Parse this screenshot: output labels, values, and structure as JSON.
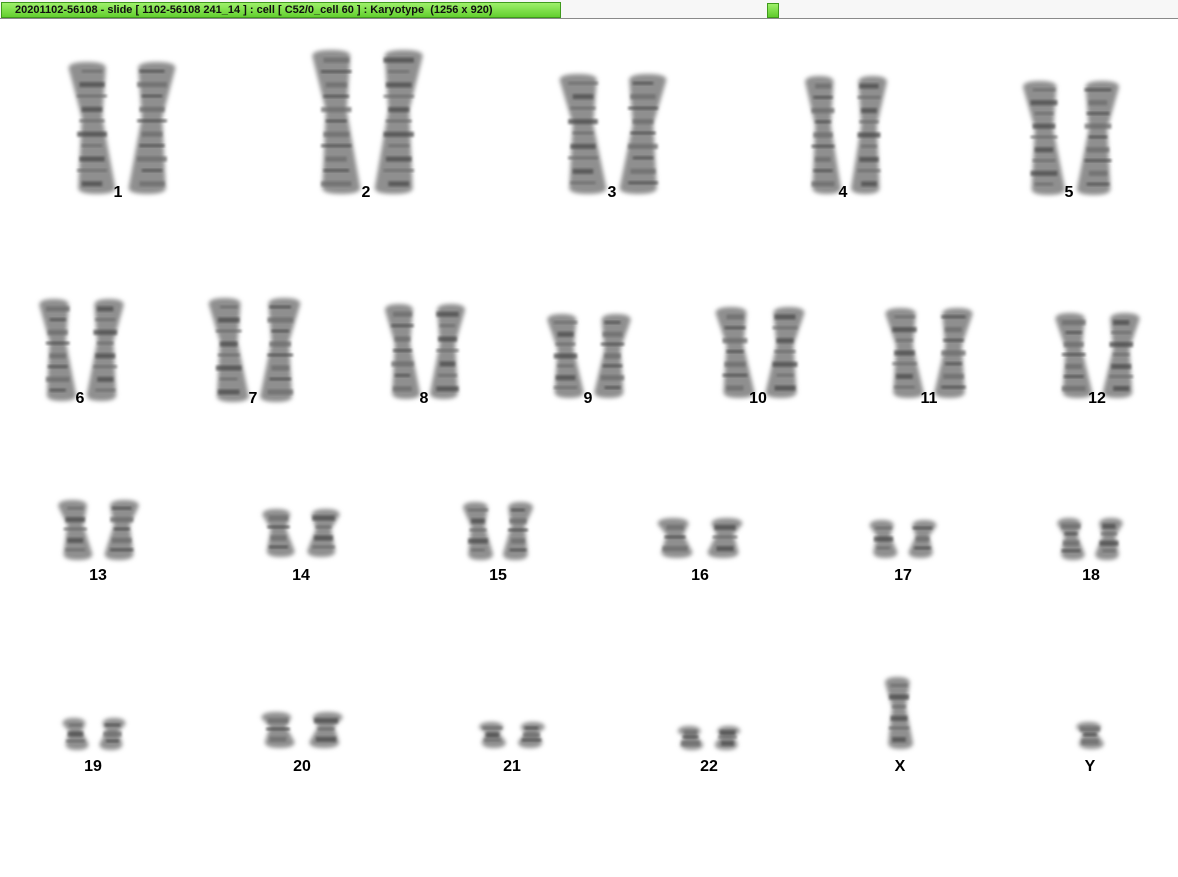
{
  "window": {
    "title": "20201102-56108 - slide [ 1102-56108 241_14 ] : cell [ C52/0_cell 60 ] : Karyotype  (1256 x 920)"
  },
  "karyotype": {
    "chromosomes": [
      {
        "label": "1"
      },
      {
        "label": "2"
      },
      {
        "label": "3"
      },
      {
        "label": "4"
      },
      {
        "label": "5"
      },
      {
        "label": "6"
      },
      {
        "label": "7"
      },
      {
        "label": "8"
      },
      {
        "label": "9"
      },
      {
        "label": "10"
      },
      {
        "label": "11"
      },
      {
        "label": "12"
      },
      {
        "label": "13"
      },
      {
        "label": "14"
      },
      {
        "label": "15"
      },
      {
        "label": "16"
      },
      {
        "label": "17"
      },
      {
        "label": "18"
      },
      {
        "label": "19"
      },
      {
        "label": "20"
      },
      {
        "label": "21"
      },
      {
        "label": "22"
      },
      {
        "label": "X"
      },
      {
        "label": "Y"
      }
    ]
  }
}
